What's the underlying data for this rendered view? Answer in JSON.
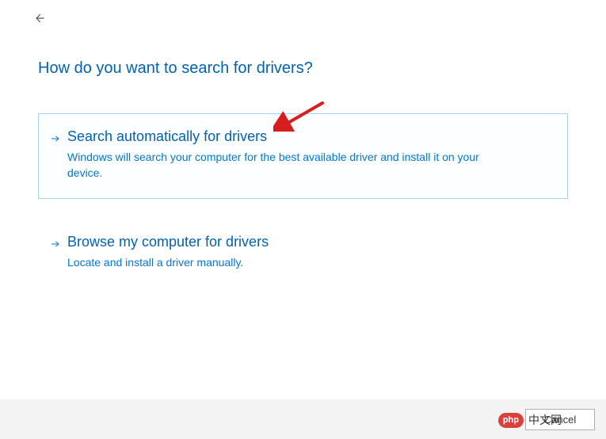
{
  "heading": "How do you want to search for drivers?",
  "options": [
    {
      "title": "Search automatically for drivers",
      "description": "Windows will search your computer for the best available driver and install it on your device."
    },
    {
      "title": "Browse my computer for drivers",
      "description": "Locate and install a driver manually."
    }
  ],
  "footer": {
    "cancel_label": "Cancel"
  },
  "watermark": {
    "badge": "php",
    "text": "中文网"
  },
  "annotation": {
    "arrow_color": "#d71e1e"
  }
}
